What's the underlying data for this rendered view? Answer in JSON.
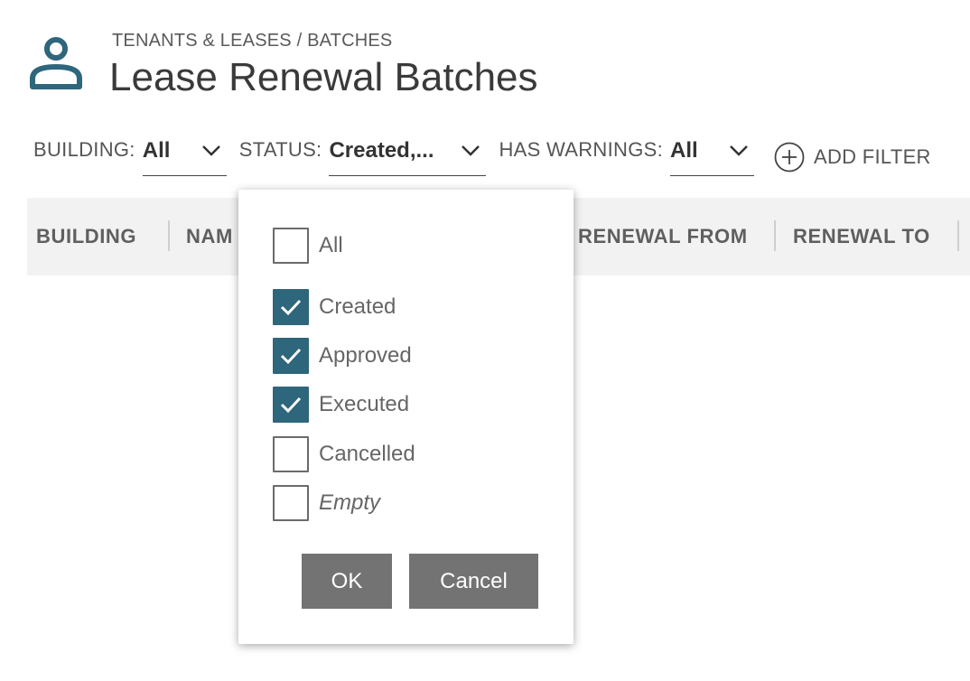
{
  "header": {
    "breadcrumb": "TENANTS & LEASES / BATCHES",
    "title": "Lease Renewal Batches",
    "icon": "person-icon",
    "icon_color": "#2e667c"
  },
  "filters": {
    "building": {
      "label": "BUILDING:",
      "value": "All"
    },
    "status": {
      "label": "STATUS:",
      "value": "Created,..."
    },
    "warnings": {
      "label": "HAS WARNINGS:",
      "value": "All"
    },
    "add_filter": "ADD FILTER"
  },
  "table": {
    "columns": [
      "BUILDING",
      "NAM",
      "RENEWAL FROM",
      "RENEWAL TO"
    ]
  },
  "status_dropdown": {
    "options": [
      {
        "label": "All",
        "checked": false
      },
      {
        "label": "Created",
        "checked": true
      },
      {
        "label": "Approved",
        "checked": true
      },
      {
        "label": "Executed",
        "checked": true
      },
      {
        "label": "Cancelled",
        "checked": false
      },
      {
        "label": "Empty",
        "checked": false
      }
    ],
    "ok_label": "OK",
    "cancel_label": "Cancel",
    "checked_color": "#2e667c",
    "button_color": "#737373"
  }
}
